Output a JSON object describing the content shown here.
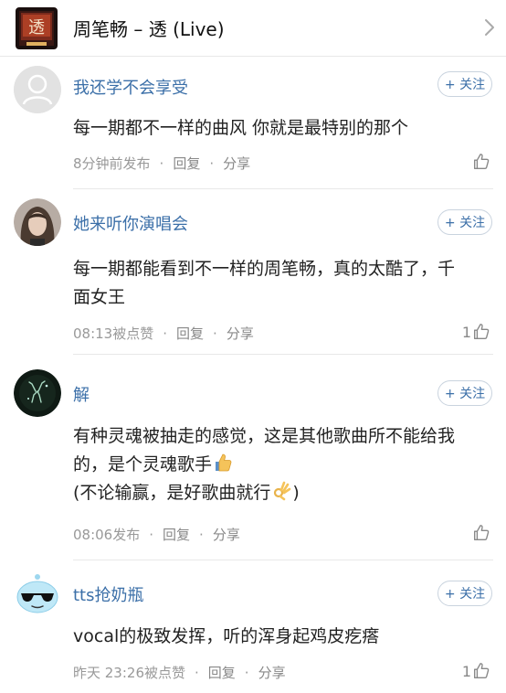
{
  "header": {
    "song_title": "周笔畅 – 透 (Live)",
    "cover_lettering": "透"
  },
  "comments": [
    {
      "username": "我还学不会享受",
      "follow_label": "+ 关注",
      "text": "每一期都不一样的曲风 你就是最特别的那个",
      "time": "8分钟前发布",
      "reply_label": "回复",
      "share_label": "分享",
      "likes": "",
      "avatar": "default-avatar"
    },
    {
      "username": "她来听你演唱会",
      "follow_label": "+ 关注",
      "text": "每一期都能看到不一样的周笔畅，真的太酷了，千面女王",
      "time": "08:13被点赞",
      "reply_label": "回复",
      "share_label": "分享",
      "likes": "1",
      "avatar": "photo-avatar"
    },
    {
      "username": "解",
      "follow_label": "+ 关注",
      "text_line1": "有种灵魂被抽走的感觉，这是其他歌曲所不能给我的，是个灵魂歌手",
      "text_line2": "(不论输赢，是好歌曲就行",
      "text_line2_end": ")",
      "emoji1": "thumbs-up-emoji",
      "emoji2": "ok-hand-emoji",
      "time": "08:06发布",
      "reply_label": "回复",
      "share_label": "分享",
      "likes": "",
      "avatar": "deer-avatar"
    },
    {
      "username": "tts抢奶瓶",
      "follow_label": "+ 关注",
      "text": "vocal的极致发挥，听的浑身起鸡皮疙瘩",
      "time": "昨天 23:26被点赞",
      "reply_label": "回复",
      "share_label": "分享",
      "likes": "1",
      "avatar": "sunglasses-cartoon-avatar"
    }
  ],
  "colors": {
    "username": "#3b6fa8",
    "meta": "#999999",
    "divider": "#e8e8e8",
    "follow_border": "#c9d3de"
  }
}
